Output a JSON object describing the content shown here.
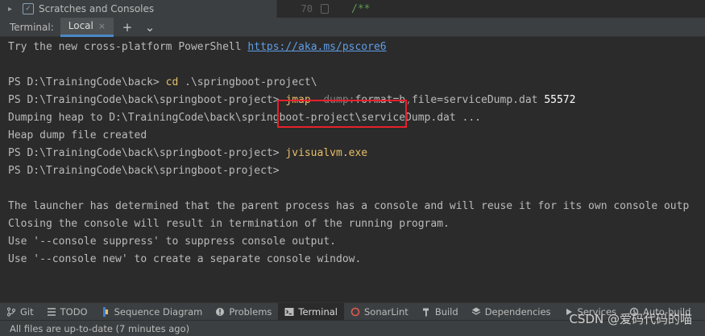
{
  "project_panel": {
    "item": "Scratches and Consoles"
  },
  "editor": {
    "line_number": "70",
    "code": "/**"
  },
  "terminal_header": {
    "title": "Terminal:",
    "tab_label": "Local",
    "close_glyph": "×",
    "add_glyph": "+",
    "menu_glyph": "⌄"
  },
  "terminal": {
    "l1_text": "Try the new cross-platform PowerShell ",
    "l1_link": "https://aka.ms/pscore6",
    "l3_prompt": "PS D:\\TrainingCode\\back> ",
    "l3_cmd": "cd",
    "l3_arg": " .\\springboot-project\\",
    "l4_prompt": "PS D:\\TrainingCode\\back\\springboot-project> ",
    "l4_cmd": "jmap",
    "l4_param": " -dump:",
    "l4_arg1": "format=b",
    "l4_comma": ",",
    "l4_arg2": "file=serviceDump.dat ",
    "l4_num": "55572",
    "l5": "Dumping heap to D:\\TrainingCode\\back\\springboot-project\\serviceDump.dat ...",
    "l6": "Heap dump file created",
    "l7_prompt": "PS D:\\TrainingCode\\back\\springboot-project> ",
    "l7_cmd": "jvisualvm.exe",
    "l8_prompt": "PS D:\\TrainingCode\\back\\springboot-project>",
    "l10": "The launcher has determined that the parent process has a console and will reuse it for its own console outp",
    "l11": "Closing the console will result in termination of the running program.",
    "l12": "Use '--console suppress' to suppress console output.",
    "l13": "Use '--console new' to create a separate console window."
  },
  "tool_windows": [
    {
      "label": "Git",
      "icon": "git-branch-icon"
    },
    {
      "label": "TODO",
      "icon": "todo-list-icon"
    },
    {
      "label": "Sequence Diagram",
      "icon": "sequence-diagram-icon"
    },
    {
      "label": "Problems",
      "icon": "problems-icon"
    },
    {
      "label": "Terminal",
      "icon": "terminal-icon"
    },
    {
      "label": "SonarLint",
      "icon": "sonarlint-icon"
    },
    {
      "label": "Build",
      "icon": "build-hammer-icon"
    },
    {
      "label": "Dependencies",
      "icon": "dependencies-icon"
    },
    {
      "label": "Services",
      "icon": "services-icon"
    },
    {
      "label": "Auto-build",
      "icon": "auto-build-icon"
    }
  ],
  "status": {
    "text": "All files are up-to-date (7 minutes ago)"
  },
  "watermark": "CSDN @爱码代码的喵",
  "colors": {
    "highlight_box": "#e8202a",
    "prompt_cmd": "#e8bf6a",
    "link": "#5f9ee8",
    "active_tab_underline": "#4a88c7"
  }
}
